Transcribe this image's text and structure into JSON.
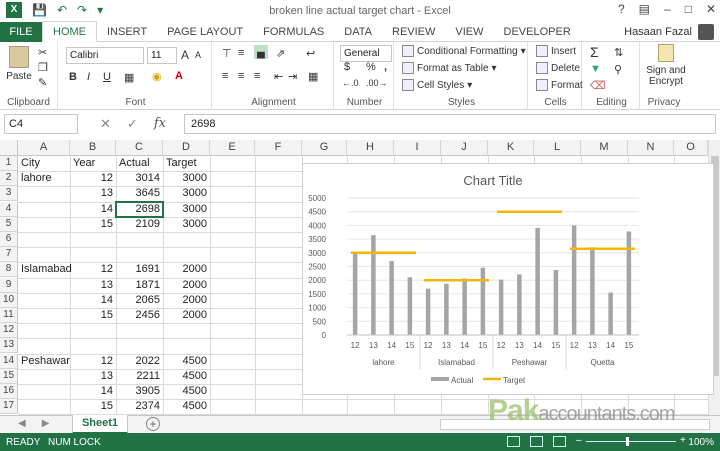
{
  "window": {
    "title": "broken line actual target chart - Excel",
    "user": "Hasaan Fazal"
  },
  "ribbon_tabs": [
    "FILE",
    "HOME",
    "INSERT",
    "PAGE LAYOUT",
    "FORMULAS",
    "DATA",
    "REVIEW",
    "VIEW",
    "DEVELOPER"
  ],
  "ribbon": {
    "clipboard": {
      "label": "Clipboard",
      "paste": "Paste"
    },
    "font": {
      "label": "Font",
      "name": "Calibri",
      "size": "11",
      "bold": "B",
      "italic": "I",
      "underline": "U",
      "grow": "A",
      "shrink": "A"
    },
    "alignment": {
      "label": "Alignment"
    },
    "number": {
      "label": "Number",
      "format": "General",
      "currency": "$",
      "percent": "%",
      "comma": ","
    },
    "styles": {
      "label": "Styles",
      "conditional": "Conditional Formatting",
      "table": "Format as Table",
      "cell": "Cell Styles"
    },
    "cells": {
      "label": "Cells",
      "insert": "Insert",
      "delete": "Delete",
      "format": "Format"
    },
    "editing": {
      "label": "Editing"
    },
    "privacy": {
      "label": "Privacy",
      "sign": "Sign and Encrypt"
    }
  },
  "formula_bar": {
    "name_box": "C4",
    "value": "2698",
    "fx": "fx"
  },
  "columns": [
    "A",
    "B",
    "C",
    "D",
    "E",
    "F",
    "G",
    "H",
    "I",
    "J",
    "K",
    "L",
    "M",
    "N",
    "O"
  ],
  "rows": [
    "1",
    "2",
    "3",
    "4",
    "5",
    "6",
    "7",
    "8",
    "9",
    "10",
    "11",
    "12",
    "13",
    "14",
    "15",
    "16",
    "17"
  ],
  "cells": {
    "header": [
      "City",
      "Year",
      "Actual",
      "Target"
    ],
    "data": [
      {
        "row": 2,
        "city": "lahore",
        "year": "12",
        "actual": "3014",
        "target": "3000"
      },
      {
        "row": 3,
        "city": "",
        "year": "13",
        "actual": "3645",
        "target": "3000"
      },
      {
        "row": 4,
        "city": "",
        "year": "14",
        "actual": "2698",
        "target": "3000"
      },
      {
        "row": 5,
        "city": "",
        "year": "15",
        "actual": "2109",
        "target": "3000"
      },
      {
        "row": 8,
        "city": "Islamabad",
        "year": "12",
        "actual": "1691",
        "target": "2000"
      },
      {
        "row": 9,
        "city": "",
        "year": "13",
        "actual": "1871",
        "target": "2000"
      },
      {
        "row": 10,
        "city": "",
        "year": "14",
        "actual": "2065",
        "target": "2000"
      },
      {
        "row": 11,
        "city": "",
        "year": "15",
        "actual": "2456",
        "target": "2000"
      },
      {
        "row": 14,
        "city": "Peshawar",
        "year": "12",
        "actual": "2022",
        "target": "4500"
      },
      {
        "row": 15,
        "city": "",
        "year": "13",
        "actual": "2211",
        "target": "4500"
      },
      {
        "row": 16,
        "city": "",
        "year": "14",
        "actual": "3905",
        "target": "4500"
      },
      {
        "row": 17,
        "city": "",
        "year": "15",
        "actual": "2374",
        "target": "4500"
      }
    ]
  },
  "sheet_tabs": [
    "Sheet1"
  ],
  "status": {
    "ready": "READY",
    "numlock": "NUM LOCK",
    "zoom": "100%"
  },
  "watermark": {
    "brand": "Pak",
    "rest": "accountants.com"
  },
  "chart_data": {
    "type": "bar",
    "title": "Chart Title",
    "groups": [
      "lahore",
      "Islamabad",
      "Peshawar",
      "Quetta"
    ],
    "years": [
      "12",
      "13",
      "14",
      "15"
    ],
    "series": [
      {
        "name": "Actual",
        "color": "#a5a5a5",
        "values": [
          3014,
          3645,
          2698,
          2109,
          1691,
          1871,
          2065,
          2456,
          2022,
          2211,
          3905,
          2374,
          4000,
          3200,
          1550,
          3780
        ]
      },
      {
        "name": "Target",
        "color": "#f2b705",
        "type": "line",
        "values": [
          3000,
          2000,
          4500,
          3150
        ]
      }
    ],
    "ylim": [
      0,
      5000
    ],
    "yticks": [
      "0",
      "500",
      "1000",
      "1500",
      "2000",
      "2500",
      "3000",
      "3500",
      "4000",
      "4500",
      "5000"
    ],
    "legend": "bottom"
  }
}
